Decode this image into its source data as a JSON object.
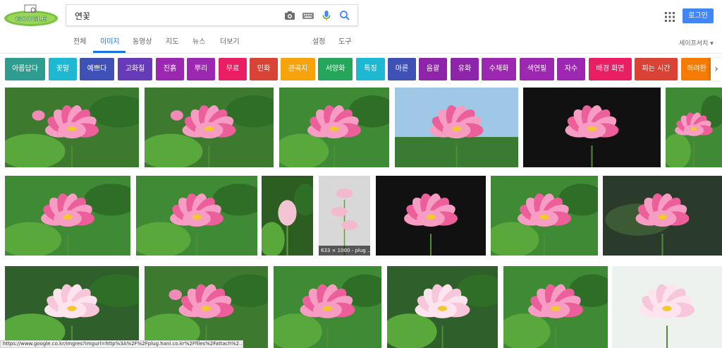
{
  "search": {
    "query": "연꽃"
  },
  "header": {
    "login_label": "로그인",
    "tabs": [
      {
        "label": "전체"
      },
      {
        "label": "이미지",
        "active": true
      },
      {
        "label": "동영상"
      },
      {
        "label": "지도"
      },
      {
        "label": "뉴스"
      },
      {
        "label": "더보기"
      },
      {
        "label": "설정"
      },
      {
        "label": "도구"
      }
    ],
    "safesearch_label": "세이프서치 ▾"
  },
  "chips": [
    {
      "label": "아름답다",
      "color": "#2e9d8f"
    },
    {
      "label": "꽃말",
      "color": "#1fb8d2"
    },
    {
      "label": "예쁘다",
      "color": "#3f51b5"
    },
    {
      "label": "고화질",
      "color": "#673ab7"
    },
    {
      "label": "진흙",
      "color": "#9c27b0"
    },
    {
      "label": "뿌리",
      "color": "#9c27b0"
    },
    {
      "label": "무료",
      "color": "#e91e63"
    },
    {
      "label": "민화",
      "color": "#d84336"
    },
    {
      "label": "관곡지",
      "color": "#f6a30c"
    },
    {
      "label": "서양화",
      "color": "#26a65b"
    },
    {
      "label": "특징",
      "color": "#1fb8d2"
    },
    {
      "label": "마른",
      "color": "#3f51b5"
    },
    {
      "label": "음괄",
      "color": "#8e24aa"
    },
    {
      "label": "유화",
      "color": "#8e24aa"
    },
    {
      "label": "수채화",
      "color": "#9c27b0"
    },
    {
      "label": "색연필",
      "color": "#9c27b0"
    },
    {
      "label": "자수",
      "color": "#9c27b0"
    },
    {
      "label": "배경 화면",
      "color": "#e91e63"
    },
    {
      "label": "피는 시간",
      "color": "#d84336"
    },
    {
      "label": "하려한",
      "color": "#f57c00"
    }
  ],
  "results": {
    "caption_4": "633 × 1000 - plug ..."
  },
  "status": {
    "url": "https://www.google.co.kr/imgres?imgurl=http%3A%2F%2Fplug.hani.co.kr%2Ffiles%2Fattach%2..."
  },
  "colors": {
    "accent": "#1a73e8",
    "login": "#4285f4"
  }
}
